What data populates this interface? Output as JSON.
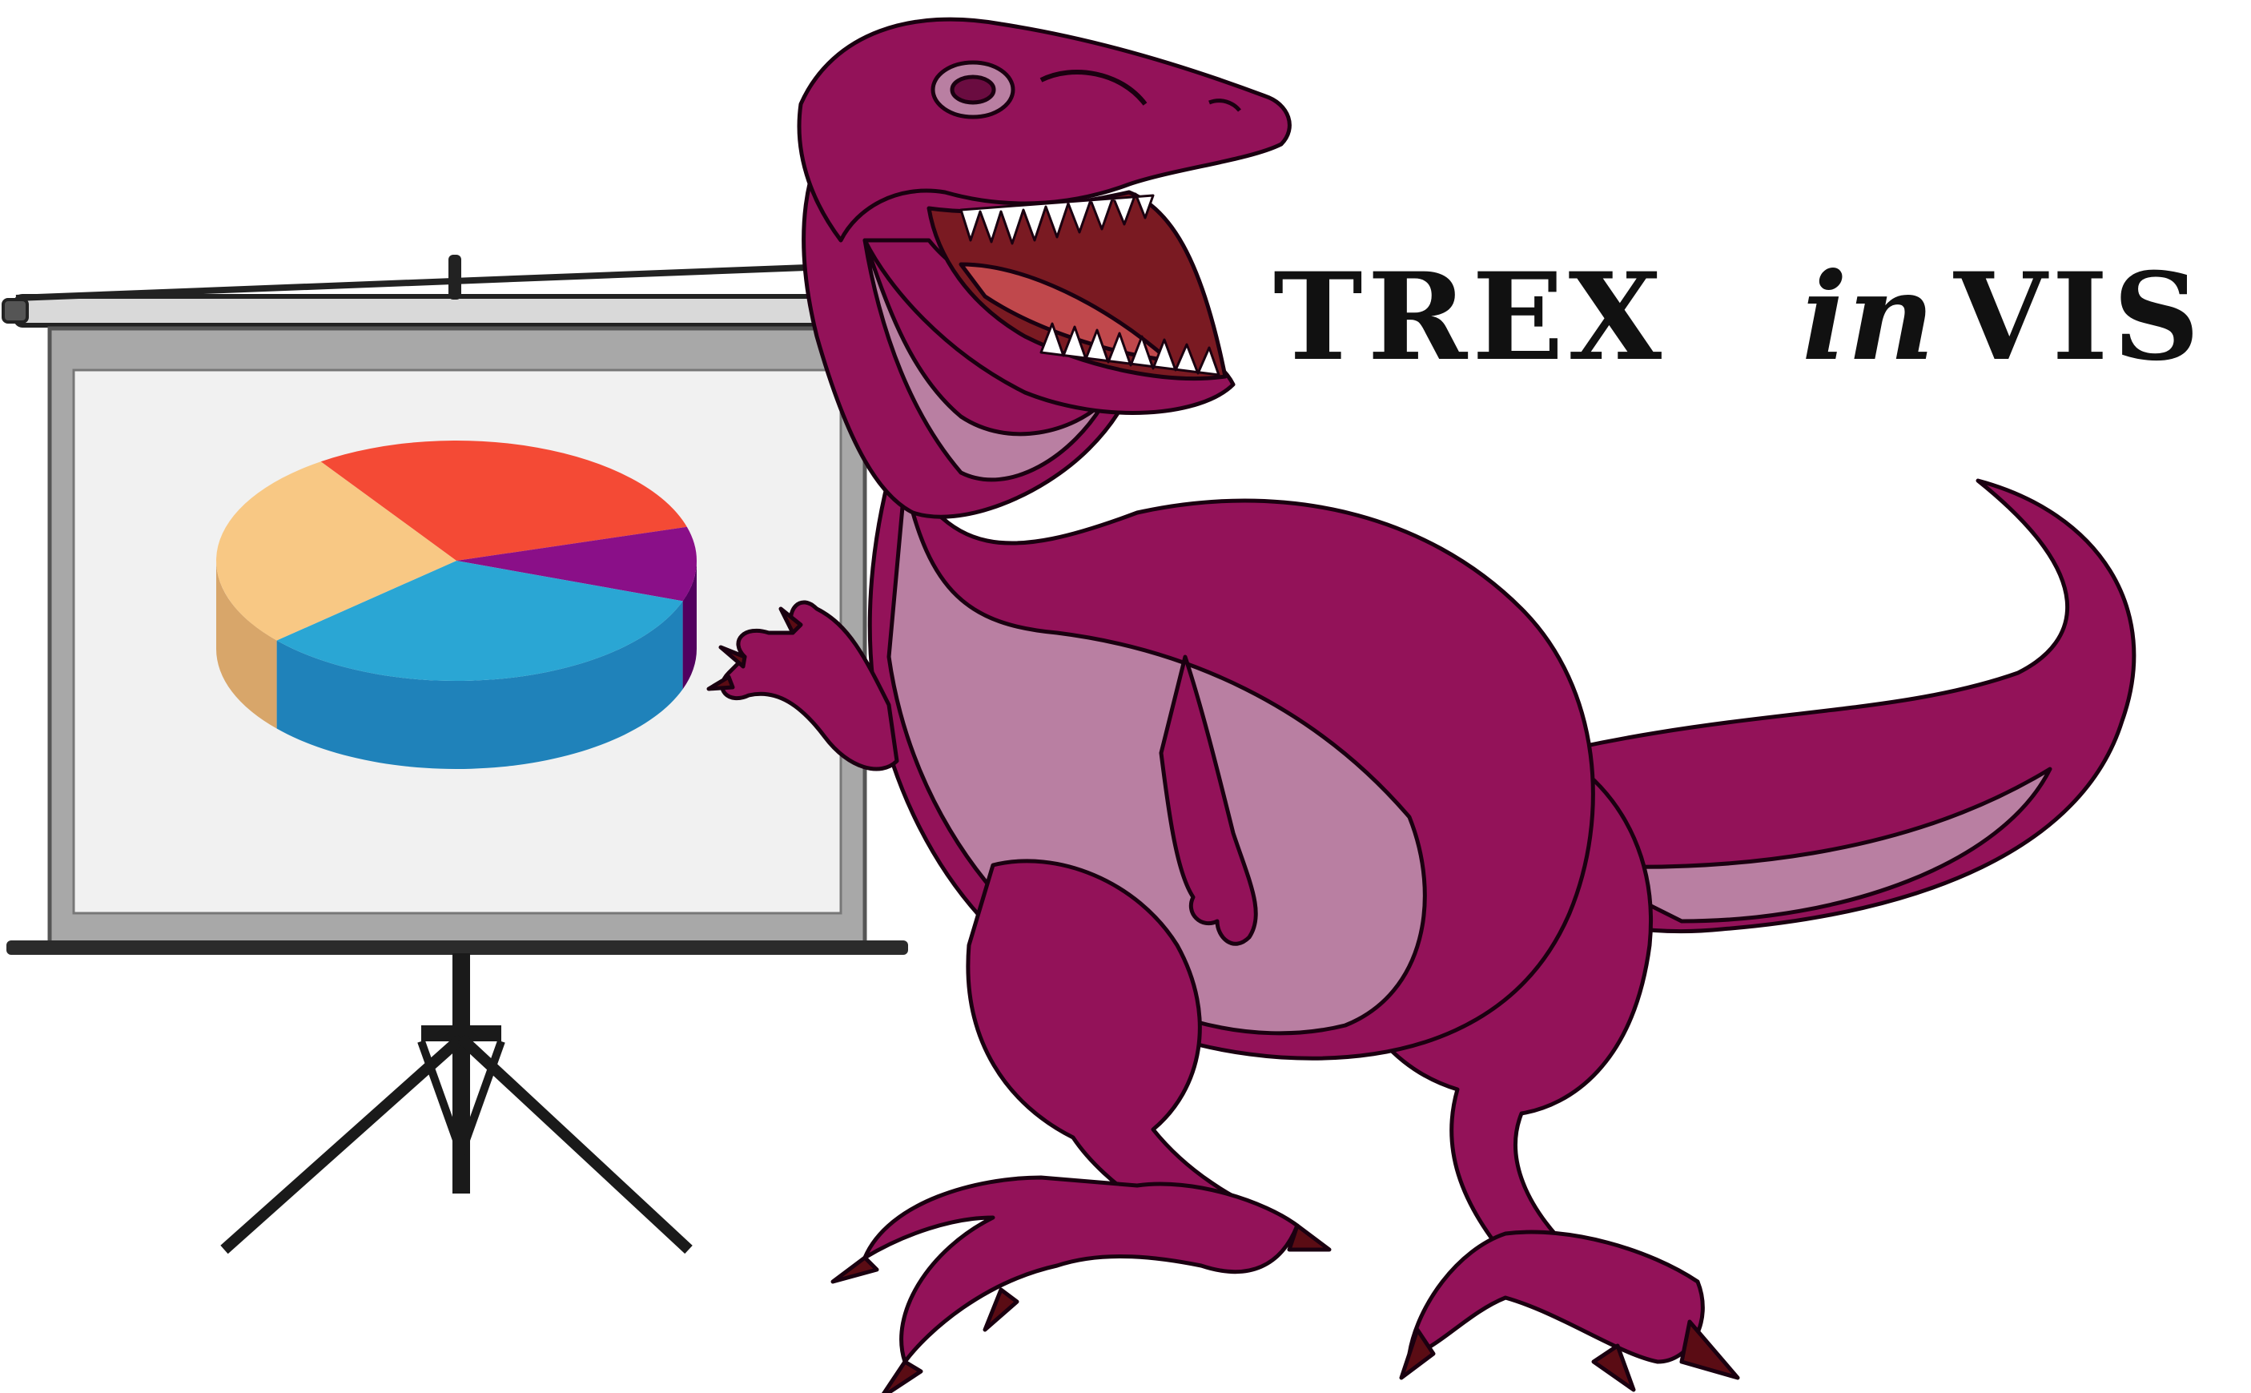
{
  "title": {
    "word1": "TREX",
    "word2": "in",
    "word3": "VIS"
  },
  "icons": {
    "projector": "projector-screen-icon",
    "pie": "pie-chart-3d-icon",
    "dinosaur": "trex-dinosaur-icon"
  },
  "pie_slices": [
    {
      "key": "red",
      "fraction": 0.3,
      "color": "#f44a35",
      "side": "#b23324"
    },
    {
      "key": "purple",
      "fraction": 0.1,
      "color": "#8a0f88",
      "side": "#52005f"
    },
    {
      "key": "blue",
      "fraction": 0.33,
      "color": "#2aa6d4",
      "side": "#1f82ba"
    },
    {
      "key": "peach",
      "fraction": 0.27,
      "color": "#f8c884",
      "side": "#d8a66a"
    }
  ],
  "colors": {
    "dino_body": "#931259",
    "dino_dark": "#6a0c40",
    "dino_belly": "#b97fa2",
    "dino_mouth": "#7a1a22",
    "screen_frame": "#a8a8a8",
    "screen_face": "#f1f1f1",
    "stand": "#1a1a1a"
  }
}
